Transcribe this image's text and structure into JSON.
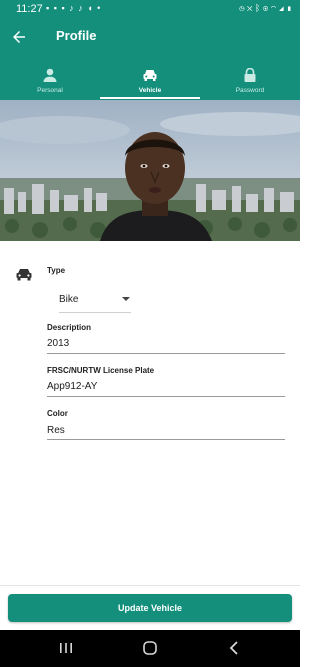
{
  "status_bar": {
    "time": "11:27",
    "notification_icons": [
      "message-icon",
      "facebook-icon",
      "image-icon",
      "tiktok-icon",
      "tiktok-icon",
      "shield-icon",
      "dot-icon"
    ],
    "system_icons": [
      "alarm-icon",
      "mute-icon",
      "bluetooth-icon",
      "location-icon",
      "wifi-icon",
      "signal-icon",
      "battery-icon"
    ]
  },
  "app_bar": {
    "title": "Profile",
    "back_icon": "arrow-left-icon"
  },
  "tabs": [
    {
      "label": "Personal",
      "icon": "person-icon",
      "active": false
    },
    {
      "label": "Vehicle",
      "icon": "car-icon",
      "active": true
    },
    {
      "label": "Password",
      "icon": "lock-icon",
      "active": false
    }
  ],
  "form": {
    "type_label": "Type",
    "type_value": "Bike",
    "description_label": "Description",
    "description_value": "2013",
    "plate_label": "FRSC/NURTW License Plate",
    "plate_value": "App912-AY",
    "color_label": "Color",
    "color_value": "Res"
  },
  "update_button_label": "Update Vehicle",
  "colors": {
    "primary": "#138f7c",
    "tab_inactive_text": "#c9ebe4",
    "text": "#222222",
    "underline": "#9a9a9a"
  }
}
